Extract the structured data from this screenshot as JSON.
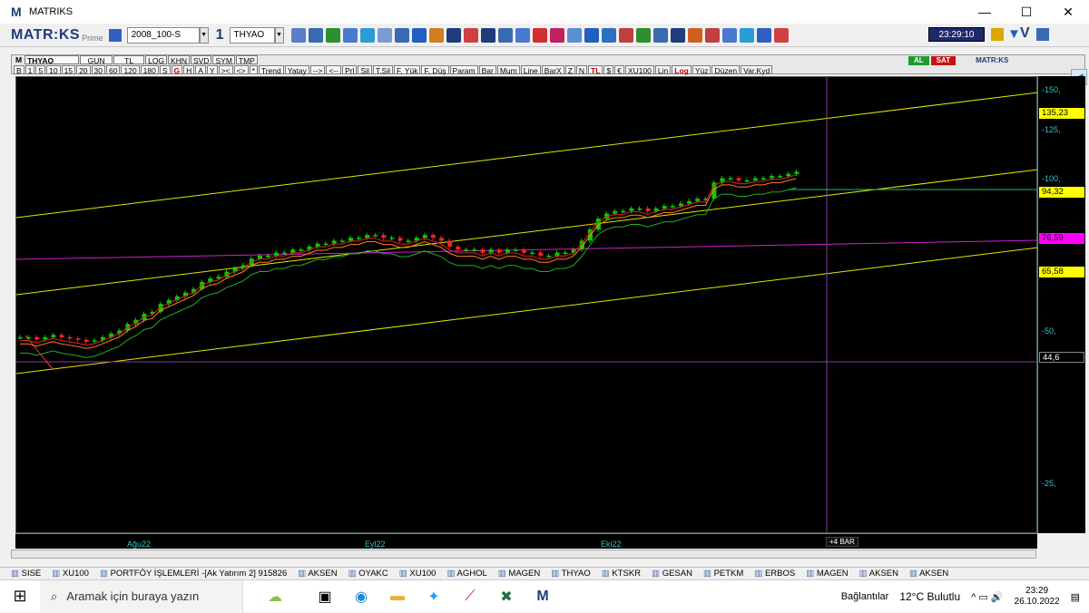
{
  "window": {
    "title": "MATRIKS",
    "logo": "M",
    "controls": [
      "—",
      "☐",
      "✕"
    ]
  },
  "toolbar": {
    "brand": "MATR:KS",
    "brand_sub": "Prime",
    "layout_name": "2008_100-S",
    "page_number": "1",
    "symbol": "THYAO",
    "clock": "23:29:10",
    "icon_names": [
      "zoom-icon",
      "cursor-icon",
      "connect-icon",
      "chart-icon",
      "globe-icon",
      "monitor-icon",
      "clock-icon",
      "list-icon",
      "bold-icon",
      "font-color-icon",
      "underline-icon",
      "settings-icon",
      "vop-icon",
      "formula-icon",
      "users-icon",
      "alert-icon",
      "mail-icon"
    ]
  },
  "chart_toolbar": {
    "symbol": "THYAO",
    "period": "GUN",
    "currency": "TL",
    "row1_top": [
      "LOG",
      "KHN",
      "SVD",
      "SYM",
      "TMP"
    ],
    "row2": [
      "B",
      "1",
      "5",
      "10",
      "15",
      "20",
      "30",
      "60",
      "120",
      "180",
      "S",
      "G",
      "H",
      "A",
      "Y",
      "><",
      "<>",
      "*",
      "Trend",
      "Yatay",
      "-->",
      "<--",
      "Prl",
      "Sil",
      "T.Sil",
      "F. Yük",
      "F. Düş",
      "Param",
      "Bar",
      "Mum",
      "Line",
      "BarX",
      "Z",
      "N",
      "TL",
      "$",
      "€",
      "XU100",
      "Lin",
      "Log",
      "Yüz",
      "Düzen",
      "Var.Kyd"
    ],
    "buy_label": "AL",
    "sell_label": "SAT",
    "brand_small": "MATR:KS"
  },
  "chart_data": {
    "type": "candlestick",
    "title": "",
    "ylabel": "",
    "xlabel": "",
    "yscale": "log",
    "ylim": [
      20,
      160
    ],
    "y_ticks": [
      150,
      125,
      100,
      50,
      25
    ],
    "x_labels": [
      "Ağu22",
      "Eyl22",
      "Eki22"
    ],
    "extra_label": "+4 BAR",
    "price_tags": [
      {
        "value": "135,23",
        "color": "#ffff00"
      },
      {
        "value": "94,32",
        "color": "#ffff00"
      },
      {
        "value": "76,59",
        "color": "#ff00ff"
      },
      {
        "value": "65,58",
        "color": "#ffff00"
      },
      {
        "value": "44,6",
        "color": "#000000"
      }
    ],
    "colors": {
      "up": "#00d000",
      "down": "#ff2020",
      "channel": "#e6e600",
      "magenta": "#d020d0",
      "ma_orange": "#ff7f27",
      "ma_red": "#e02020",
      "ma_green": "#20b020",
      "vertical": "#8a3aa0"
    }
  },
  "taskline": [
    "SISE",
    "XU100",
    "PORTFÖY İŞLEMLERİ -[Ak Yatırım 2] 915826",
    "AKSEN",
    "OYAKC",
    "XU100",
    "AGHOL",
    "MAGEN",
    "THYAO",
    "KTSKR",
    "GESAN",
    "PETKM",
    "ERBOS",
    "MAGEN",
    "AKSEN",
    "AKSEN"
  ],
  "taskbar": {
    "search_placeholder": "Aramak için buraya yazın",
    "tray_label": "Bağlantılar",
    "weather": "12°C Bulutlu",
    "time": "23:29",
    "date": "26.10.2022"
  }
}
